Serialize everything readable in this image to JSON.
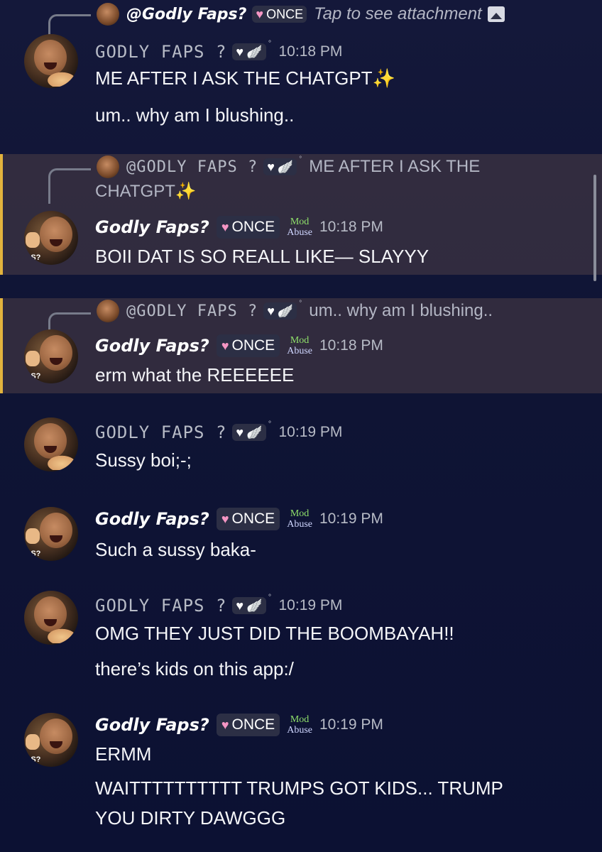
{
  "users": {
    "a_name": "GODLY FAPS ?",
    "b_name": "Godly Faps?",
    "b_mention": "@Godly Faps?",
    "a_mention": "@GODLY FAPS ?",
    "once_label": "ONCE",
    "mod_line1": "Mod",
    "mod_line2": "Abuse",
    "avatar_text": "PS?"
  },
  "top_reply": {
    "snippet": "Tap to see attachment"
  },
  "messages": [
    {
      "author": "GODLY FAPS ?",
      "time": "10:18 PM",
      "lines": [
        "ME AFTER I ASK THE CHATGPT✨",
        "um.. why am I blushing.."
      ]
    },
    {
      "author": "Godly Faps?",
      "time": "10:18 PM",
      "reply_snippet_1": "ME AFTER I ASK THE",
      "reply_snippet_2": "CHATGPT✨",
      "lines": [
        "BOII DAT IS SO REALL LIKE— SLAYYY"
      ]
    },
    {
      "author": "Godly Faps?",
      "time": "10:18 PM",
      "reply_snippet_1": "um.. why am I blushing..",
      "lines": [
        "erm what the REEEEEE"
      ]
    },
    {
      "author": "GODLY FAPS ?",
      "time": "10:19 PM",
      "lines": [
        "Sussy boi;-;"
      ]
    },
    {
      "author": "Godly Faps?",
      "time": "10:19 PM",
      "lines": [
        "Such a sussy baka-"
      ]
    },
    {
      "author": "GODLY FAPS ?",
      "time": "10:19 PM",
      "lines": [
        "OMG THEY JUST DID THE BOOMBAYAH!!",
        "there’s kids on this app:/"
      ]
    },
    {
      "author": "Godly Faps?",
      "time": "10:19 PM",
      "lines": [
        "ERMM",
        "WAITTTTTTTTTT TRUMPS GOT KIDS... TRUMP",
        "YOU DIRTY DAWGGG"
      ]
    }
  ],
  "icons": {
    "pink_heart": "♥",
    "white_heart": "♥",
    "wing": "🪽"
  },
  "colors": {
    "background": "#10153a",
    "highlight_border": "#e2b33d",
    "mod_green": "#8fe06a",
    "once_heart": "#f596c4"
  }
}
